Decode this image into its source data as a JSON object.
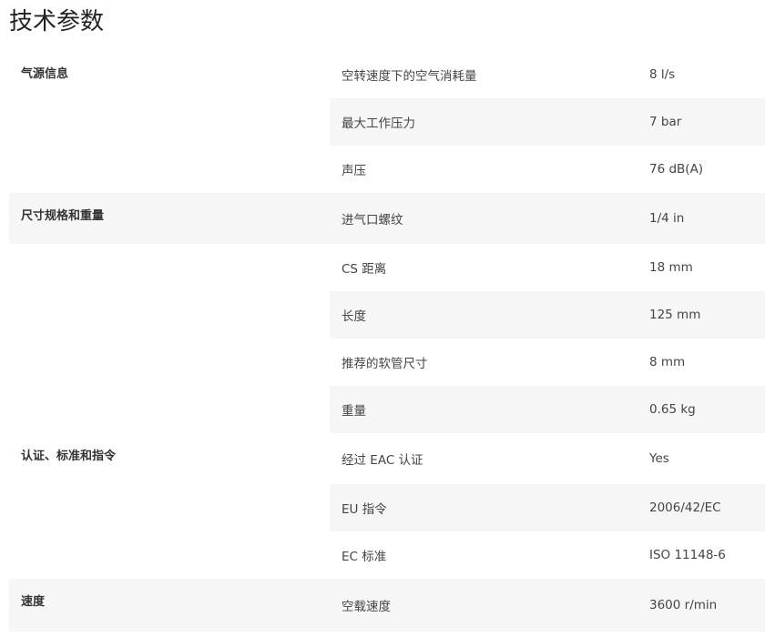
{
  "title": "技术参数",
  "groups": [
    {
      "name": "气源信息",
      "rows": [
        {
          "label": "空转速度下的空气消耗量",
          "value": "8 l/s"
        },
        {
          "label": "最大工作压力",
          "value": "7 bar"
        },
        {
          "label": "声压",
          "value": "76 dB(A)"
        }
      ]
    },
    {
      "name": "尺寸规格和重量",
      "rows": [
        {
          "label": "进气口螺纹",
          "value": "1/4 in"
        },
        {
          "label": "CS 距离",
          "value": "18 mm"
        },
        {
          "label": "长度",
          "value": "125 mm"
        },
        {
          "label": "推荐的软管尺寸",
          "value": "8 mm"
        },
        {
          "label": "重量",
          "value": "0.65 kg"
        }
      ]
    },
    {
      "name": "认证、标准和指令",
      "rows": [
        {
          "label": "经过 EAC 认证",
          "value": "Yes"
        },
        {
          "label": "EU 指令",
          "value": "2006/42/EC"
        },
        {
          "label": "EC 标准",
          "value": "ISO 11148-6"
        }
      ]
    },
    {
      "name": "速度",
      "rows": [
        {
          "label": "空载速度",
          "value": "3600 r/min"
        }
      ]
    }
  ]
}
